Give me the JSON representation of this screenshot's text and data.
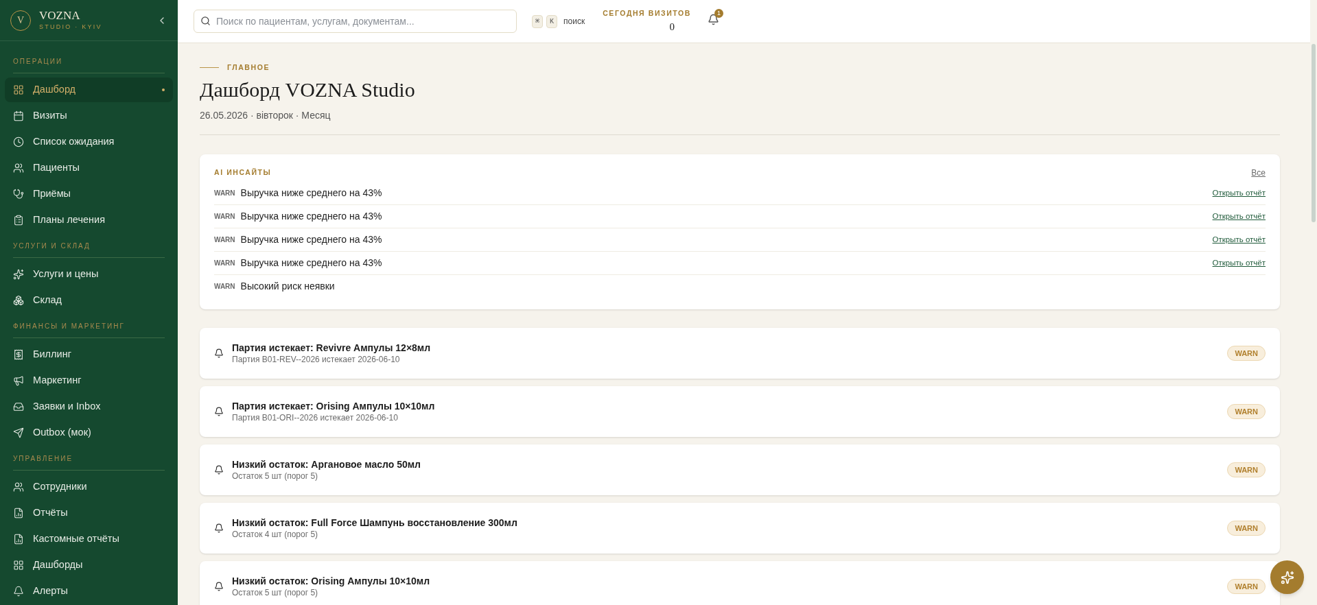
{
  "sidebar": {
    "brand": {
      "logo_letter": "V",
      "name": "VOZNA",
      "subtitle": "STUDIO · KYIV"
    },
    "sections": [
      {
        "title": "ОПЕРАЦИИ",
        "items": [
          {
            "label": "Дашборд",
            "selected": true
          },
          {
            "label": "Визиты",
            "selected": false
          },
          {
            "label": "Список ожидания",
            "selected": false
          },
          {
            "label": "Пациенты",
            "selected": false
          },
          {
            "label": "Приёмы",
            "selected": false
          },
          {
            "label": "Планы лечения",
            "selected": false
          }
        ]
      },
      {
        "title": "УСЛУГИ И СКЛАД",
        "items": [
          {
            "label": "Услуги и цены",
            "selected": false
          },
          {
            "label": "Склад",
            "selected": false
          }
        ]
      },
      {
        "title": "ФИНАНСЫ И МАРКЕТИНГ",
        "items": [
          {
            "label": "Биллинг",
            "selected": false
          },
          {
            "label": "Маркетинг",
            "selected": false
          },
          {
            "label": "Заявки и Inbox",
            "selected": false
          },
          {
            "label": "Outbox (мок)",
            "selected": false
          }
        ]
      },
      {
        "title": "УПРАВЛЕНИЕ",
        "items": [
          {
            "label": "Сотрудники",
            "selected": false
          },
          {
            "label": "Отчёты",
            "selected": false
          },
          {
            "label": "Кастомные отчёты",
            "selected": false
          },
          {
            "label": "Дашборды",
            "selected": false
          },
          {
            "label": "Алерты",
            "selected": false
          }
        ]
      }
    ]
  },
  "topbar": {
    "search": {
      "placeholder": "Поиск по пациентам, услугам, документам..."
    },
    "shortcut_keys": [
      "⌘",
      "K"
    ],
    "shortcut_label": "поиск",
    "today_visits": {
      "label": "СЕГОДНЯ ВИЗИТОВ",
      "value": "0"
    },
    "notifications_count": "1"
  },
  "header": {
    "eyebrow": "ГЛАВНОЕ",
    "title": "Дашборд VOZNA Studio",
    "subtitle": "26.05.2026 · вівторок · Месяц"
  },
  "insights": {
    "title": "AI ИНСАЙТЫ",
    "all_link": "Все",
    "rows": [
      {
        "tag": "WARN",
        "text": "Выручка ниже среднего на 43%",
        "link": "Открыть отчёт"
      },
      {
        "tag": "WARN",
        "text": "Выручка ниже среднего на 43%",
        "link": "Открыть отчёт"
      },
      {
        "tag": "WARN",
        "text": "Выручка ниже среднего на 43%",
        "link": "Открыть отчёт"
      },
      {
        "tag": "WARN",
        "text": "Выручка ниже среднего на 43%",
        "link": "Открыть отчёт"
      },
      {
        "tag": "WARN",
        "text": "Высокий риск неявки"
      }
    ]
  },
  "alerts": [
    {
      "title": "Партия истекает: Revivre Ампулы 12×8мл",
      "detail": "Партия B01-REV--2026 истекает 2026-06-10",
      "badge": "WARN"
    },
    {
      "title": "Партия истекает: Orising Ампулы 10×10мл",
      "detail": "Партия B01-ORI--2026 истекает 2026-06-10",
      "badge": "WARN"
    },
    {
      "title": "Низкий остаток: Аргановое масло 50мл",
      "detail": "Остаток 5 шт (порог 5)",
      "badge": "WARN"
    },
    {
      "title": "Низкий остаток: Full Force Шампунь восстановление 300мл",
      "detail": "Остаток 4 шт (порог 5)",
      "badge": "WARN"
    },
    {
      "title": "Низкий остаток: Orising Ампулы 10×10мл",
      "detail": "Остаток 5 шт (порог 5)",
      "badge": "WARN"
    }
  ]
}
